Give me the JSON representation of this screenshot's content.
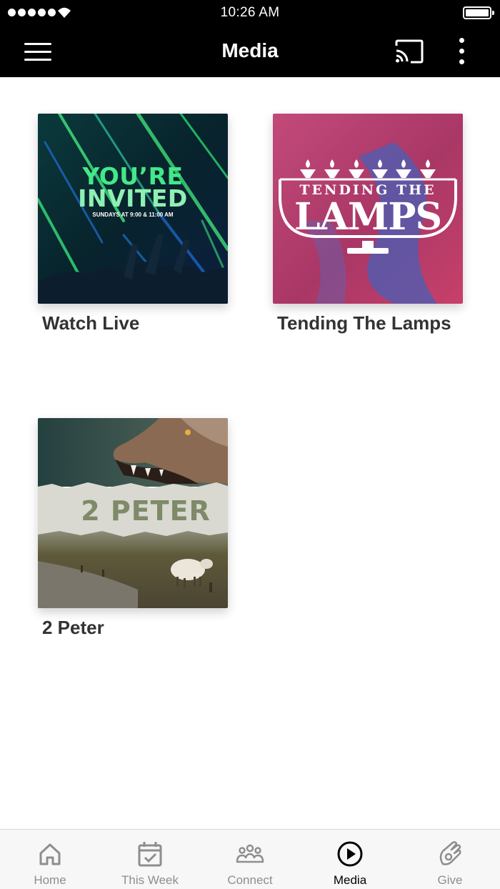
{
  "status_bar": {
    "time": "10:26 AM"
  },
  "header": {
    "title": "Media",
    "icons": [
      "menu-icon",
      "cast-icon",
      "more-vertical-icon"
    ]
  },
  "media_items": [
    {
      "title": "Watch Live",
      "artwork": {
        "headline_1": "YOU’RE",
        "headline_2": "INVITED",
        "subtitle": "SUNDAYS AT 9:00 & 11:00 AM",
        "colors": {
          "background": "#08232c",
          "accent": "#3ee07a",
          "streak_blue": "#1f6fd6"
        }
      }
    },
    {
      "title": "Tending The Lamps",
      "artwork": {
        "line_1": "TENDING THE",
        "line_2": "LAMPS",
        "colors": {
          "background": "#b33a6a",
          "accent_blue": "#4a5fb6",
          "ink": "#ffffff"
        }
      }
    },
    {
      "title": "2 Peter",
      "artwork": {
        "headline": "2 PETER",
        "colors": {
          "top": "#2d4a4a",
          "band": "#d9d9d2",
          "text": "#7e8a68",
          "field": "#6b5d3c"
        }
      }
    }
  ],
  "tab_bar": {
    "active": "Media",
    "tabs": [
      {
        "label": "Home",
        "icon": "home-icon"
      },
      {
        "label": "This Week",
        "icon": "calendar-check-icon"
      },
      {
        "label": "Connect",
        "icon": "people-group-icon"
      },
      {
        "label": "Media",
        "icon": "play-circle-icon"
      },
      {
        "label": "Give",
        "icon": "give-hand-icon"
      }
    ]
  }
}
